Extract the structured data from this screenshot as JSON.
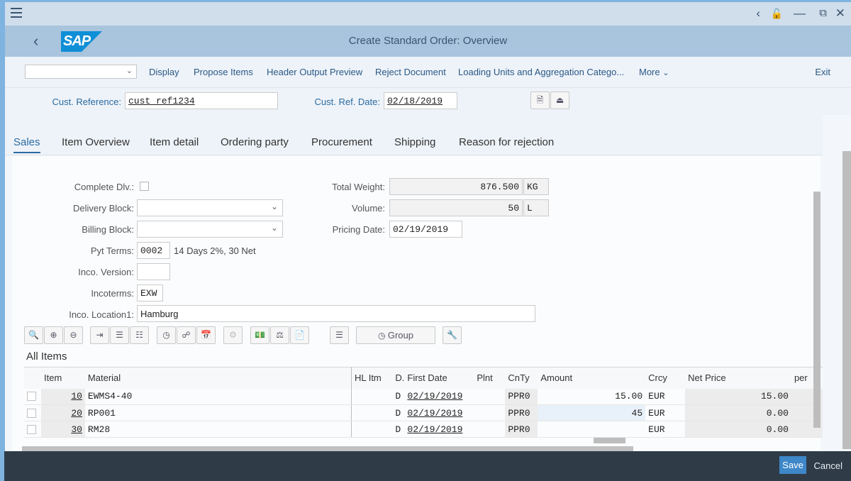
{
  "window": {
    "menu_icon": "hamburger-menu-icon",
    "controls": [
      "back-icon",
      "unlock-icon",
      "minimize-icon",
      "restore-icon",
      "close-icon"
    ]
  },
  "shell": {
    "back_icon": "back-chevron-icon",
    "logo": "SAP",
    "title": "Create Standard Order: Overview"
  },
  "toolbar": {
    "select_value": "",
    "buttons": [
      "Display",
      "Propose Items",
      "Header Output Preview",
      "Reject Document",
      "Loading Units and Aggregation Catego...",
      "More"
    ],
    "exit": "Exit"
  },
  "header": {
    "cust_reference_label": "Cust. Reference:",
    "cust_reference_value": "cust_ref1234",
    "cust_ref_date_label": "Cust. Ref. Date:",
    "cust_ref_date_value": "02/18/2019"
  },
  "tabs": [
    "Sales",
    "Item Overview",
    "Item detail",
    "Ordering party",
    "Procurement",
    "Shipping",
    "Reason for rejection"
  ],
  "active_tab": "Sales",
  "sales": {
    "complete_dlv_label": "Complete Dlv.:",
    "complete_dlv_checked": false,
    "delivery_block_label": "Delivery Block:",
    "delivery_block_value": "",
    "billing_block_label": "Billing Block:",
    "billing_block_value": "",
    "pyt_terms_label": "Pyt Terms:",
    "pyt_terms_value": "0002",
    "pyt_terms_desc": "14 Days 2%, 30 Net",
    "inco_version_label": "Inco. Version:",
    "inco_version_value": "",
    "incoterms_label": "Incoterms:",
    "incoterms_value": "EXW",
    "inco_location_label": "Inco. Location1:",
    "inco_location_value": "Hamburg",
    "total_weight_label": "Total Weight:",
    "total_weight_value": "876.500",
    "total_weight_unit": "KG",
    "volume_label": "Volume:",
    "volume_value": "50",
    "volume_unit": "L",
    "pricing_date_label": "Pricing Date:",
    "pricing_date_value": "02/19/2019"
  },
  "items_toolbar": {
    "group_label": "Group"
  },
  "items": {
    "title": "All Items",
    "columns": [
      "",
      "Item",
      "Material",
      "HL Itm",
      "D.",
      "First Date",
      "Plnt",
      "CnTy",
      "Amount",
      "Crcy",
      "Net Price",
      "per"
    ],
    "rows": [
      {
        "item": "10",
        "material": "EWMS4-40",
        "hl_itm": "",
        "d": "D",
        "first_date": "02/19/2019",
        "plnt": "",
        "cnty": "PPR0",
        "amount": "15.00",
        "crcy": "EUR",
        "net_price": "15.00",
        "per": ""
      },
      {
        "item": "20",
        "material": "RP001",
        "hl_itm": "",
        "d": "D",
        "first_date": "02/19/2019",
        "plnt": "",
        "cnty": "PPR0",
        "amount": "45",
        "crcy": "EUR",
        "net_price": "0.00",
        "per": ""
      },
      {
        "item": "30",
        "material": "RM28",
        "hl_itm": "",
        "d": "D",
        "first_date": "02/19/2019",
        "plnt": "",
        "cnty": "PPR0",
        "amount": "",
        "crcy": "EUR",
        "net_price": "0.00",
        "per": ""
      }
    ]
  },
  "footer": {
    "save": "Save",
    "cancel": "Cancel"
  }
}
